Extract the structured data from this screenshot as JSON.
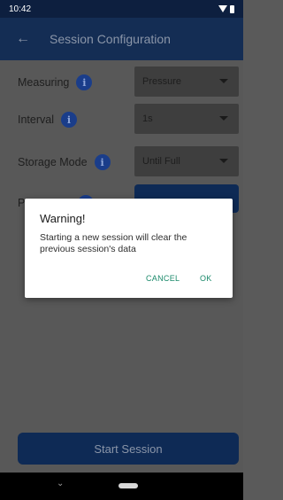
{
  "status_bar": {
    "time": "10:42"
  },
  "app_bar": {
    "back_icon": "arrow-left-icon",
    "title": "Session Configuration"
  },
  "form": {
    "rows": [
      {
        "label": "Measuring",
        "value": "Pressure"
      },
      {
        "label": "Interval",
        "value": "1s"
      },
      {
        "label": "Storage Mode",
        "value": "Until Full"
      },
      {
        "label": "P",
        "value": ""
      }
    ],
    "info_icon": "info-icon"
  },
  "start_button": {
    "label": "Start Session"
  },
  "dialog": {
    "title": "Warning!",
    "message": "Starting a new session will clear the previous session's data",
    "cancel_label": "CANCEL",
    "ok_label": "OK"
  },
  "colors": {
    "primary": "#142d54",
    "accent": "#1b8a6b"
  }
}
